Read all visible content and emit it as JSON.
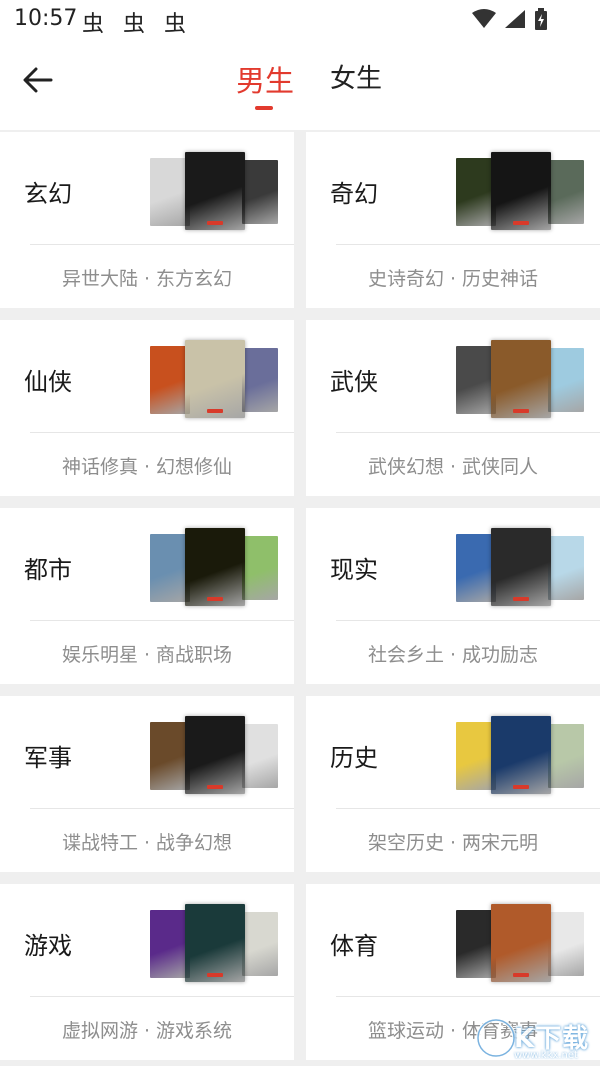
{
  "status_bar": {
    "time": "10:57",
    "notification_icons": "虫 虫 虫"
  },
  "nav": {
    "tabs": [
      {
        "label": "男生",
        "active": true
      },
      {
        "label": "女生",
        "active": false
      }
    ],
    "accent_color": "#e23a2e"
  },
  "categories": [
    {
      "title": "玄幻",
      "subtitle": "异世大陆 · 东方玄幻",
      "covers": [
        "#d8d8d8",
        "#1a1a1a",
        "#3a3a3a"
      ]
    },
    {
      "title": "奇幻",
      "subtitle": "史诗奇幻 · 历史神话",
      "covers": [
        "#2d3a1e",
        "#151515",
        "#5a6a5a"
      ]
    },
    {
      "title": "仙侠",
      "subtitle": "神话修真 · 幻想修仙",
      "covers": [
        "#c8501e",
        "#c9c2a8",
        "#6a6e9a"
      ]
    },
    {
      "title": "武侠",
      "subtitle": "武侠幻想 · 武侠同人",
      "covers": [
        "#4a4a4a",
        "#8a5a2a",
        "#9ecbe0"
      ]
    },
    {
      "title": "都市",
      "subtitle": "娱乐明星 · 商战职场",
      "covers": [
        "#6a8fb0",
        "#1a1a0a",
        "#8fbf6a"
      ]
    },
    {
      "title": "现实",
      "subtitle": "社会乡土 · 成功励志",
      "covers": [
        "#3a6ab0",
        "#2a2a2a",
        "#b8d8e8"
      ]
    },
    {
      "title": "军事",
      "subtitle": "谍战特工 · 战争幻想",
      "covers": [
        "#6a4a2a",
        "#1a1a1a",
        "#e0e0e0"
      ]
    },
    {
      "title": "历史",
      "subtitle": "架空历史 · 两宋元明",
      "covers": [
        "#e8c840",
        "#1a3a6a",
        "#b8c8a8"
      ]
    },
    {
      "title": "游戏",
      "subtitle": "虚拟网游 · 游戏系统",
      "covers": [
        "#5a2a8a",
        "#1a3a3a",
        "#d8d8d0"
      ]
    },
    {
      "title": "体育",
      "subtitle": "篮球运动 · 体育赛事",
      "covers": [
        "#2a2a2a",
        "#b05a2a",
        "#e8e8e8"
      ]
    }
  ],
  "watermark": {
    "text": "K下载",
    "url": "www.kkx.net"
  }
}
